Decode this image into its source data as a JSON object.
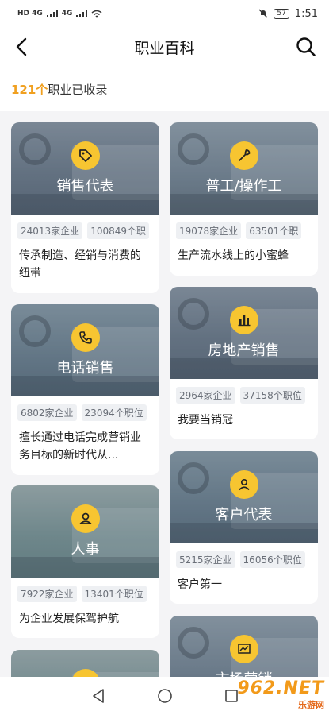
{
  "status": {
    "signal_left": "HD 4G",
    "signal_right": "4G",
    "battery": "57",
    "time": "1:51"
  },
  "header": {
    "title": "职业百科"
  },
  "summary": {
    "count": "121个",
    "text": "职业已收录"
  },
  "cards_left": [
    {
      "title": "销售代表",
      "icon": "tag-icon",
      "tag1": "24013家企业",
      "tag2": "100849个职",
      "desc": "传承制造、经销与消费的纽带"
    },
    {
      "title": "电话销售",
      "icon": "phone-icon",
      "tag1": "6802家企业",
      "tag2": "23094个职位",
      "desc": "擅长通过电话完成营销业务目标的新时代从..."
    },
    {
      "title": "人事",
      "icon": "person-icon",
      "tag1": "7922家企业",
      "tag2": "13401个职位",
      "desc": "为企业发展保驾护航"
    },
    {
      "title": "",
      "icon": "person-icon",
      "tag1": "",
      "tag2": "",
      "desc": ""
    }
  ],
  "cards_right": [
    {
      "title": "普工/操作工",
      "icon": "wrench-icon",
      "tag1": "19078家企业",
      "tag2": "63501个职",
      "desc": "生产流水线上的小蜜蜂"
    },
    {
      "title": "房地产销售",
      "icon": "bar-chart-icon",
      "tag1": "2964家企业",
      "tag2": "37158个职位",
      "desc": "我要当销冠"
    },
    {
      "title": "客户代表",
      "icon": "user-badge-icon",
      "tag1": "5215家企业",
      "tag2": "16056个职位",
      "desc": "客户第一"
    },
    {
      "title": "市场营销",
      "icon": "trend-chart-icon",
      "tag1": "",
      "tag2": "",
      "desc": ""
    }
  ],
  "watermark": {
    "top": "962.NET",
    "bottom": "乐游网"
  },
  "colors": {
    "accent": "#f0a020",
    "icon_bg": "#f7c531"
  }
}
